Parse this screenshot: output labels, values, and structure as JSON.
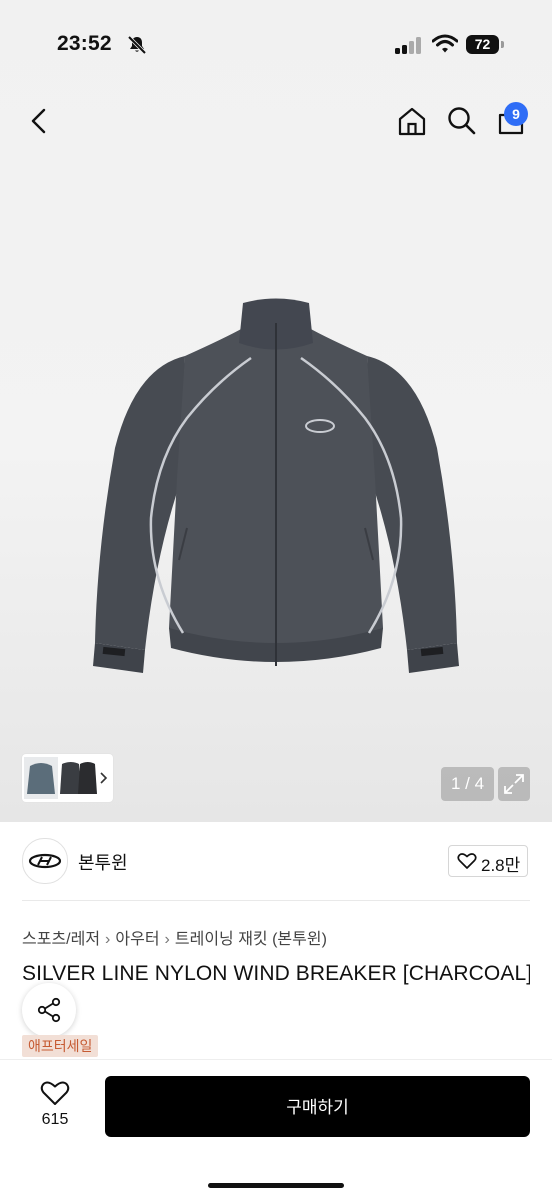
{
  "status": {
    "time": "23:52",
    "battery": "72"
  },
  "nav": {
    "cart_count": "9"
  },
  "gallery": {
    "counter": "1 / 4"
  },
  "brand": {
    "name": "본투윈",
    "likes": "2.8만"
  },
  "product": {
    "breadcrumbs": [
      "스포츠/레저",
      "아우터",
      "트레이닝 재킷 (본투윈)"
    ],
    "title": "SILVER LINE NYLON WIND BREAKER [CHARCOAL]",
    "badge": "애프터세일"
  },
  "actions": {
    "wish_count": "615",
    "buy_label": "구매하기"
  },
  "colors": {
    "accent": "#2f6df6",
    "buy_button": "#000000",
    "badge_bg": "#f2dfd6",
    "badge_text": "#c65b33",
    "jacket": "#4b4f56"
  }
}
